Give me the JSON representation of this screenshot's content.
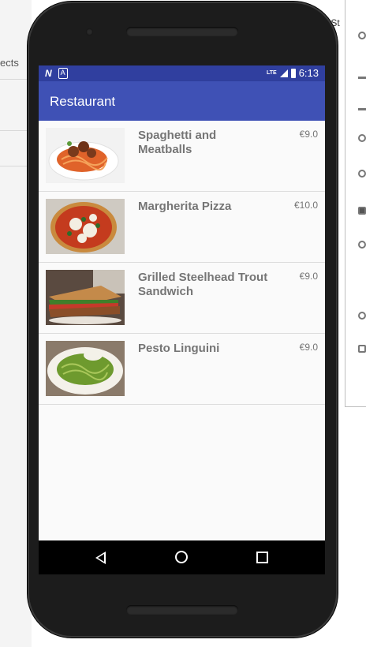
{
  "background": {
    "projects_fragment": "ects",
    "right_fragment": "r St"
  },
  "statusbar": {
    "network_badge": "LTE",
    "notification_icon_1": "N",
    "notification_icon_2": "A",
    "time": "6:13"
  },
  "appbar": {
    "title": "Restaurant",
    "color": "#3f51b5",
    "status_color": "#303f9f"
  },
  "menu_items": [
    {
      "name": "Spaghetti and Meatballs",
      "price": "€9.0",
      "image": "spaghetti-meatballs-image"
    },
    {
      "name": "Margherita Pizza",
      "price": "€10.0",
      "image": "margherita-pizza-image"
    },
    {
      "name": "Grilled Steelhead Trout Sandwich",
      "price": "€9.0",
      "image": "trout-sandwich-image"
    },
    {
      "name": "Pesto Linguini",
      "price": "€9.0",
      "image": "pesto-linguini-image"
    }
  ],
  "navbar": {
    "back_icon": "back-triangle-icon",
    "home_icon": "home-circle-icon",
    "recents_icon": "recents-square-icon"
  }
}
